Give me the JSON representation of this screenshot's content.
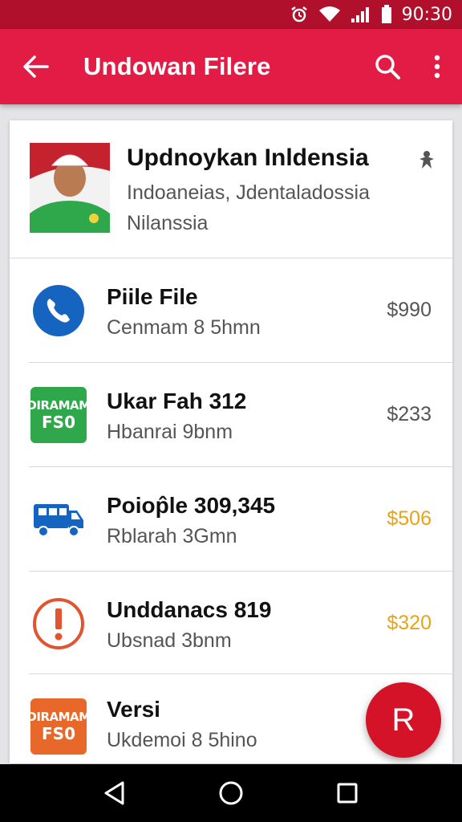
{
  "status_bar": {
    "time": "90:30"
  },
  "app_bar": {
    "title": "Undowan Filere"
  },
  "profile": {
    "name": "Updnoykan Inldensia",
    "line1": "Indoaneias, Jdentaladossia",
    "line2": "Nilanssia"
  },
  "items": [
    {
      "title": "Piile File",
      "subtitle": "Cenmam 8 5hmn",
      "price": "$990",
      "icon": "phone-icon",
      "price_color": "#555555"
    },
    {
      "title": "Ukar Fah 312",
      "subtitle": "Hbanrai 9bnm",
      "price": "$233",
      "icon": "tag-icon",
      "tag_top": "DIRAMAM",
      "tag_bottom": "FS0",
      "tag_color": "#2ea84a",
      "price_color": "#555555"
    },
    {
      "title": "Poiop̂le 309,345",
      "subtitle": "Rblarah 3Gmn",
      "price": "$506",
      "icon": "truck-icon",
      "price_color": "#e8a317"
    },
    {
      "title": "Unddanacs 819",
      "subtitle": "Ubsnad 3bnm",
      "price": "$320",
      "icon": "alert-icon",
      "price_color": "#e8a317"
    },
    {
      "title": "Versi",
      "subtitle": "Ukdemoi 8 5hino",
      "price": "",
      "icon": "tag-icon",
      "tag_top": "DIRAMAM",
      "tag_bottom": "FS0",
      "tag_color": "#e8682a"
    }
  ],
  "fab": {
    "label": "R"
  },
  "colors": {
    "status_bar": "#b0102c",
    "app_bar": "#e21c44",
    "fab": "#d41228",
    "accent_gold": "#e8a317"
  }
}
